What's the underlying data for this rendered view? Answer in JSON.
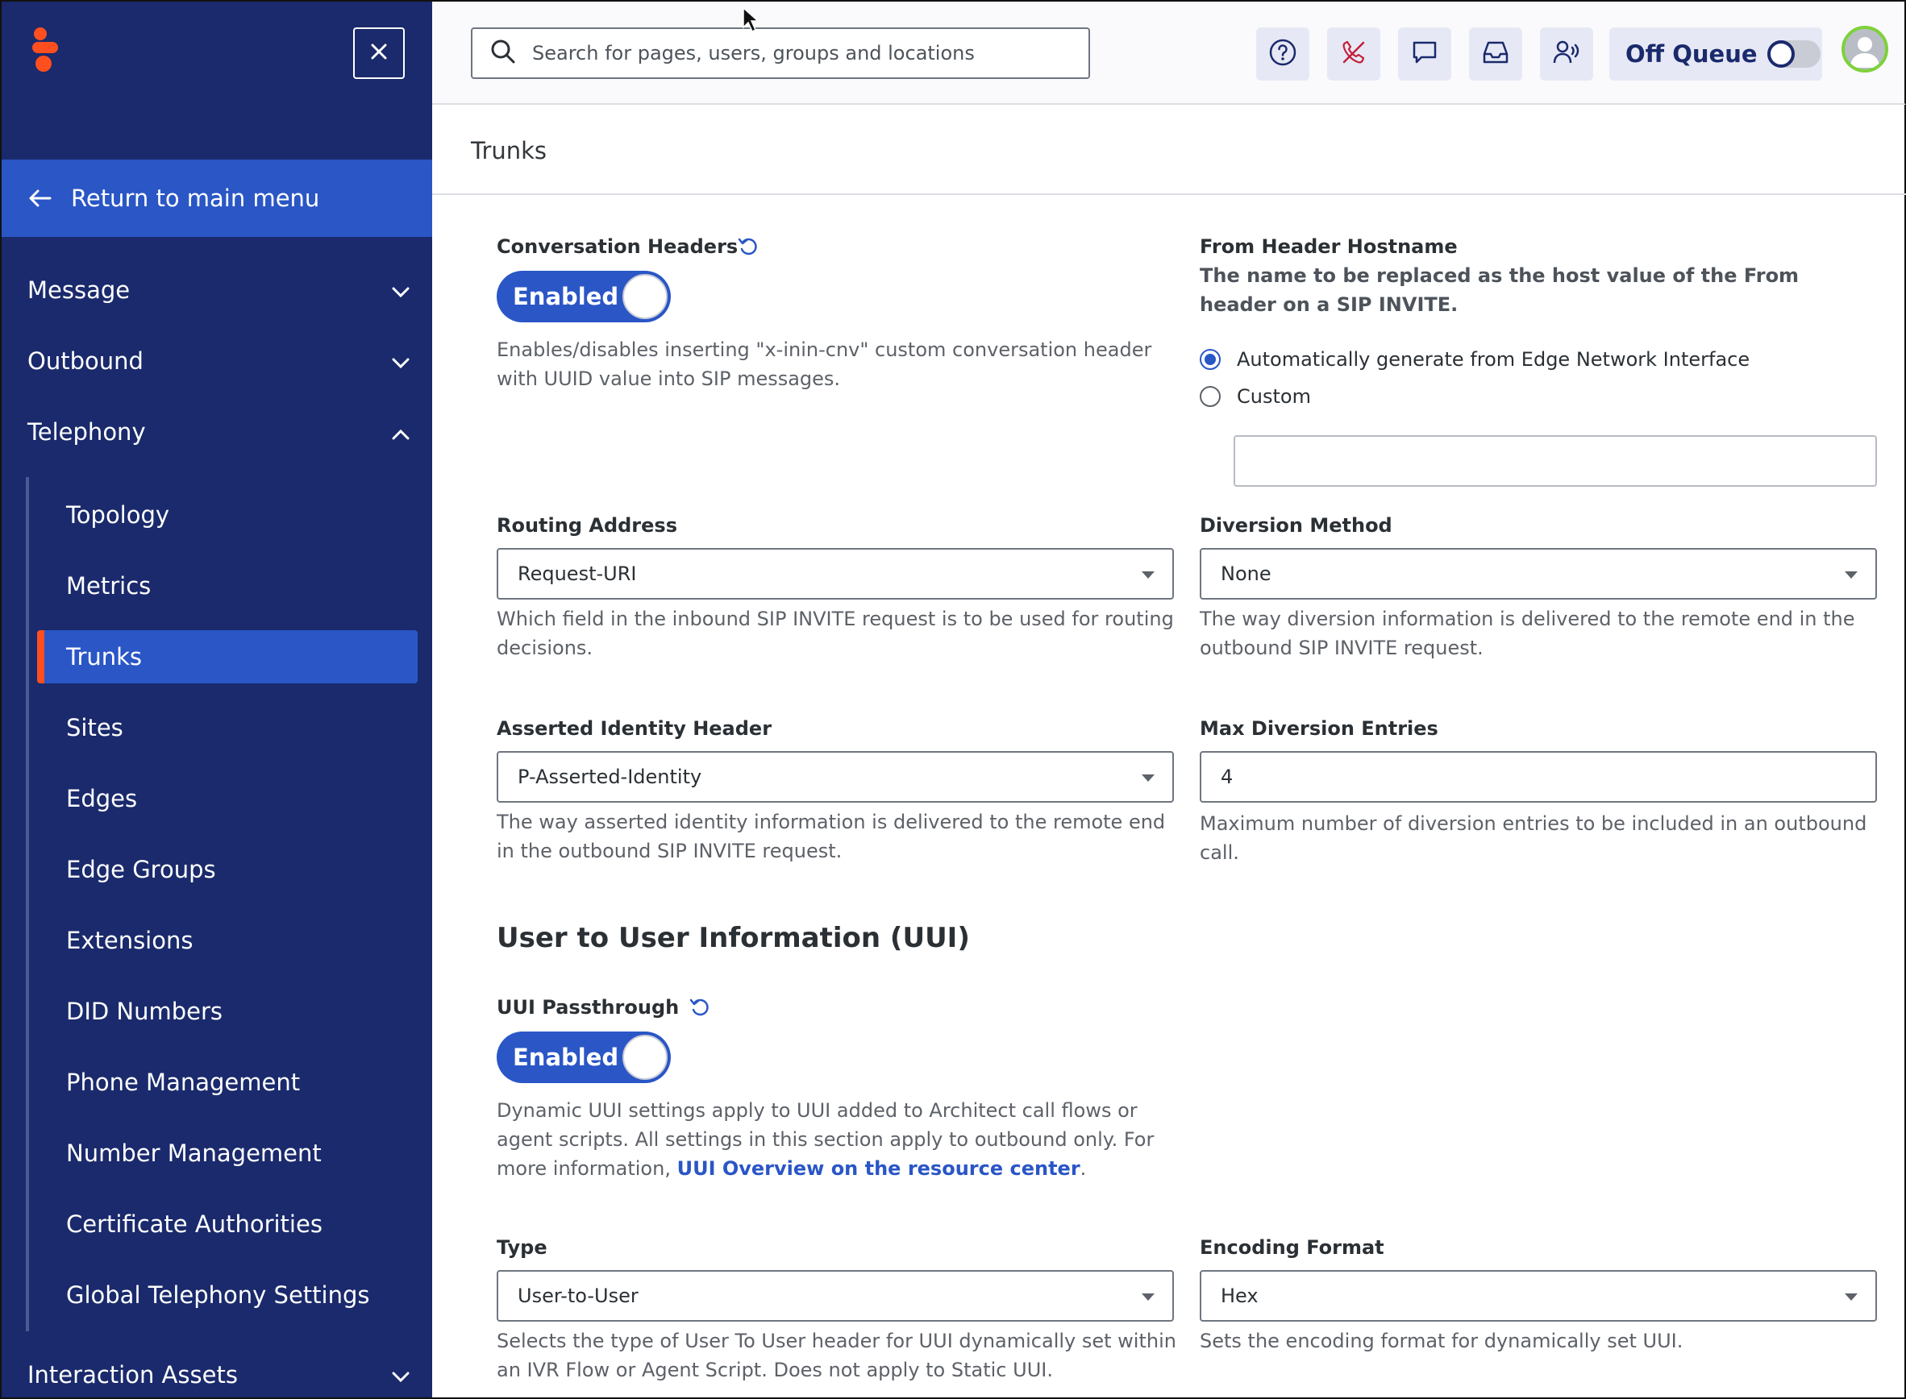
{
  "colors": {
    "sidebar_bg": "#1a2a6c",
    "accent": "#2a56c6",
    "active_marker": "#ff4f1f",
    "avatar_ring": "#7fd13a"
  },
  "sidebar": {
    "logo_icon": "genesys-logo-icon",
    "close_icon": "close-icon",
    "return_label": "Return to main menu",
    "top_items": [
      {
        "label": "Message",
        "state": "collapsed"
      },
      {
        "label": "Outbound",
        "state": "collapsed"
      },
      {
        "label": "Telephony",
        "state": "expanded"
      },
      {
        "label": "Interaction Assets",
        "state": "collapsed"
      }
    ],
    "telephony_items": [
      {
        "label": "Topology"
      },
      {
        "label": "Metrics"
      },
      {
        "label": "Trunks",
        "active": true
      },
      {
        "label": "Sites"
      },
      {
        "label": "Edges"
      },
      {
        "label": "Edge Groups"
      },
      {
        "label": "Extensions"
      },
      {
        "label": "DID Numbers"
      },
      {
        "label": "Phone Management"
      },
      {
        "label": "Number Management"
      },
      {
        "label": "Certificate Authorities"
      },
      {
        "label": "Global Telephony Settings"
      }
    ]
  },
  "topbar": {
    "search_placeholder": "Search for pages, users, groups and locations",
    "icons": [
      "help-icon",
      "phone-off-icon",
      "chat-icon",
      "inbox-icon",
      "user-voice-icon"
    ],
    "queue_label": "Off Queue",
    "queue_on": false
  },
  "main": {
    "page_title": "Trunks",
    "conversation_headers": {
      "label": "Conversation Headers",
      "toggle": "Enabled",
      "help": "Enables/disables inserting \"x-inin-cnv\" custom conversation header with UUID value into SIP messages."
    },
    "from_header": {
      "label": "From Header Hostname",
      "help": "The name to be replaced as the host value of the From header on a SIP INVITE.",
      "options": [
        "Automatically generate from Edge Network Interface",
        "Custom"
      ],
      "selected_index": 0,
      "custom_value": ""
    },
    "routing_address": {
      "label": "Routing Address",
      "value": "Request-URI",
      "help": "Which field in the inbound SIP INVITE request is to be used for routing decisions."
    },
    "diversion_method": {
      "label": "Diversion Method",
      "value": "None",
      "help": "The way diversion information is delivered to the remote end in the outbound SIP INVITE request."
    },
    "asserted_identity": {
      "label": "Asserted Identity Header",
      "value": "P-Asserted-Identity",
      "help": "The way asserted identity information is delivered to the remote end in the outbound SIP INVITE request."
    },
    "max_diversion": {
      "label": "Max Diversion Entries",
      "value": "4",
      "help": "Maximum number of diversion entries to be included in an outbound call."
    },
    "uui_section": {
      "heading": "User to User Information (UUI)",
      "passthrough_label": "UUI Passthrough",
      "toggle": "Enabled",
      "help_text": "Dynamic UUI settings apply to UUI added to Architect call flows or agent scripts. All settings in this section apply to outbound only. For more information,",
      "help_link": "UUI Overview on the resource center",
      "help_end": "."
    },
    "uui_type": {
      "label": "Type",
      "value": "User-to-User",
      "help": "Selects the type of User To User header for UUI dynamically set within an IVR Flow or Agent Script. Does not apply to Static UUI."
    },
    "encoding_format": {
      "label": "Encoding Format",
      "value": "Hex",
      "help": "Sets the encoding format for dynamically set UUI."
    }
  }
}
